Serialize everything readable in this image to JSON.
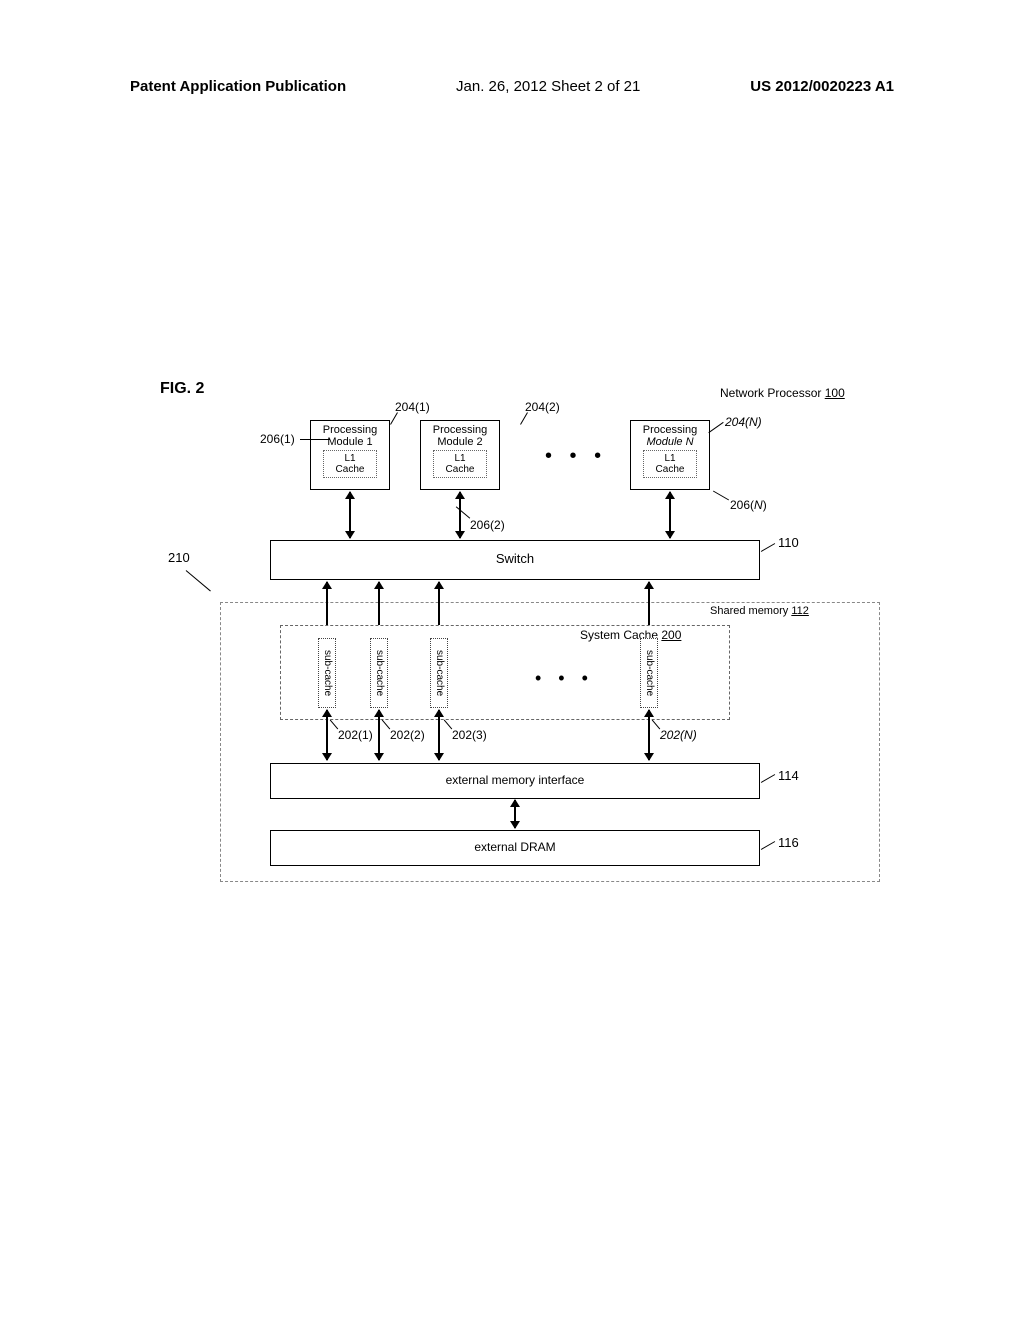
{
  "header": {
    "left": "Patent Application Publication",
    "center": "Jan. 26, 2012  Sheet 2 of 21",
    "right": "US 2012/0020223 A1"
  },
  "figure": {
    "label": "FIG. 2",
    "network_processor": "Network Processor",
    "network_processor_num": "100",
    "pm1_line1": "Processing",
    "pm1_line2": "Module 1",
    "pm2_line1": "Processing",
    "pm2_line2": "Module 2",
    "pmN_line1": "Processing",
    "pmN_line2": "Module N",
    "l1": "L1",
    "cache": "Cache",
    "dots": "• • •",
    "switch": "Switch",
    "shared_memory": "Shared memory",
    "shared_memory_num": "112",
    "system_cache": "System Cache",
    "system_cache_num": "200",
    "subcache": "sub-cache",
    "emi": "external memory interface",
    "dram": "external DRAM",
    "refs": {
      "r204_1": "204(1)",
      "r204_2": "204(2)",
      "r204_N": "204(N)",
      "r206_1": "206(1)",
      "r206_2": "206(2)",
      "r206_N": "206(N)",
      "r110": "110",
      "r210": "210",
      "r202_1": "202(1)",
      "r202_2": "202(2)",
      "r202_3": "202(3)",
      "r202_N": "202(N)",
      "r114": "114",
      "r116": "116"
    }
  }
}
